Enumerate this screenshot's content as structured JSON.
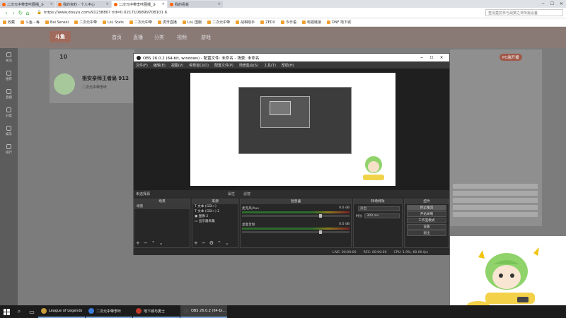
{
  "browser": {
    "tabs": [
      {
        "title": "二次元中带李咔圈播_斗"
      },
      {
        "title": "我的资料 - 个人中心"
      },
      {
        "title": "二次元中带李咔圈播_斗"
      },
      {
        "title": "我的看板"
      }
    ],
    "url": "https://www.douyu.com/9123880? rid=0.0217106899708101 6",
    "search_placeholder": "查清楚抗日与战英之日所需设备",
    "bookmarks": [
      "收藏",
      "斗鱼 - 每",
      "Bai Sensei",
      "二次元中带",
      "LoL Stats",
      "二次元中带",
      "虎牙直播",
      "LoL 国服",
      "二次元中带",
      "战棋助手",
      "ZEDX",
      "今日语",
      "电视链接",
      "DNF 地下城"
    ]
  },
  "site": {
    "logo": "斗鱼",
    "nav": [
      "首页",
      "直播",
      "分类",
      "视频",
      "游戏"
    ],
    "sidebar": [
      "关注",
      "推荐",
      "直播",
      "分类",
      "娱乐",
      "排行"
    ],
    "follow_count": "10",
    "room_title": "祖安亲师王者局 912",
    "streamer_sub": "二次元中带李咔",
    "pc_live": "PC端开播"
  },
  "obs": {
    "title": "OBS 26.0.2 (64-bit, windows) - 配置文件: 未命名 - 场景: 未命名",
    "menu": [
      "文件(F)",
      "编辑(E)",
      "视图(V)",
      "停靠窗口(D)",
      "配置文件(P)",
      "场景集合(S)",
      "工具(T)",
      "帮助(H)"
    ],
    "no_source": "未选择源",
    "properties": "属性",
    "filters": "滤镜",
    "docks": {
      "scenes": {
        "header": "场景",
        "items": [
          "场景"
        ]
      },
      "sources": {
        "header": "来源",
        "items": [
          "文本 (GDI+)",
          "文本 (GDI+) 2",
          "图像 2",
          "显示器采集"
        ]
      },
      "mixer": {
        "header": "混音器",
        "tracks": [
          {
            "name": "麦克风/Aux",
            "db": "0.0 dB",
            "level": 0.72
          },
          {
            "name": "桌面音频",
            "db": "0.0 dB",
            "level": 0.72
          }
        ]
      },
      "transitions": {
        "header": "转场特效",
        "type": "淡出",
        "duration_label": "时长",
        "duration": "300 ms"
      },
      "controls": {
        "header": "控件",
        "buttons": [
          "停止推流",
          "开始录制",
          "工作室模式",
          "设置",
          "退出"
        ]
      }
    },
    "status": [
      "LIVE: 00:00:00",
      "REC: 00:00:00",
      "CPU: 1.9%, 60.00 fps"
    ]
  },
  "taskbar": {
    "apps": [
      {
        "label": "League of Legends",
        "color": "#c89b3c"
      },
      {
        "label": "二次元中带李咔",
        "color": "#3b7dd8"
      },
      {
        "label": "地下城与勇士",
        "color": "#c0392b"
      },
      {
        "label": "OBS 26.0.2 (64-bi...",
        "color": "#444444"
      }
    ]
  }
}
